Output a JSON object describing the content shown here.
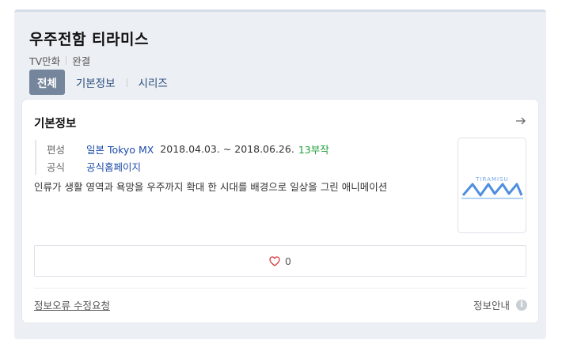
{
  "title": "우주전함 티라미스",
  "meta": {
    "type": "TV만화",
    "status": "완결"
  },
  "tabs": [
    {
      "label": "전체",
      "active": true
    },
    {
      "label": "기본정보",
      "active": false
    },
    {
      "label": "시리즈",
      "active": false
    }
  ],
  "card": {
    "title": "기본정보",
    "broadcast": {
      "label": "편성",
      "channel": "일본 Tokyo MX",
      "period": "2018.04.03. ~ 2018.06.26.",
      "episodes": "13부작"
    },
    "official": {
      "label": "공식",
      "link": "공식홈페이지"
    },
    "description": "인류가 생활 영역과 욕망을 우주까지 확대 한 시대를 배경으로 일상을 그린 애니메이션",
    "poster_text": "TIRAMISU",
    "likes": "0"
  },
  "footer": {
    "report": "정보오류 수정요청",
    "guide": "정보안내",
    "info_glyph": "i"
  },
  "colors": {
    "accent_tab": "#75859c",
    "link": "#1b4aa8",
    "episodes": "#1e9e3a",
    "heart": "#d9343a"
  }
}
